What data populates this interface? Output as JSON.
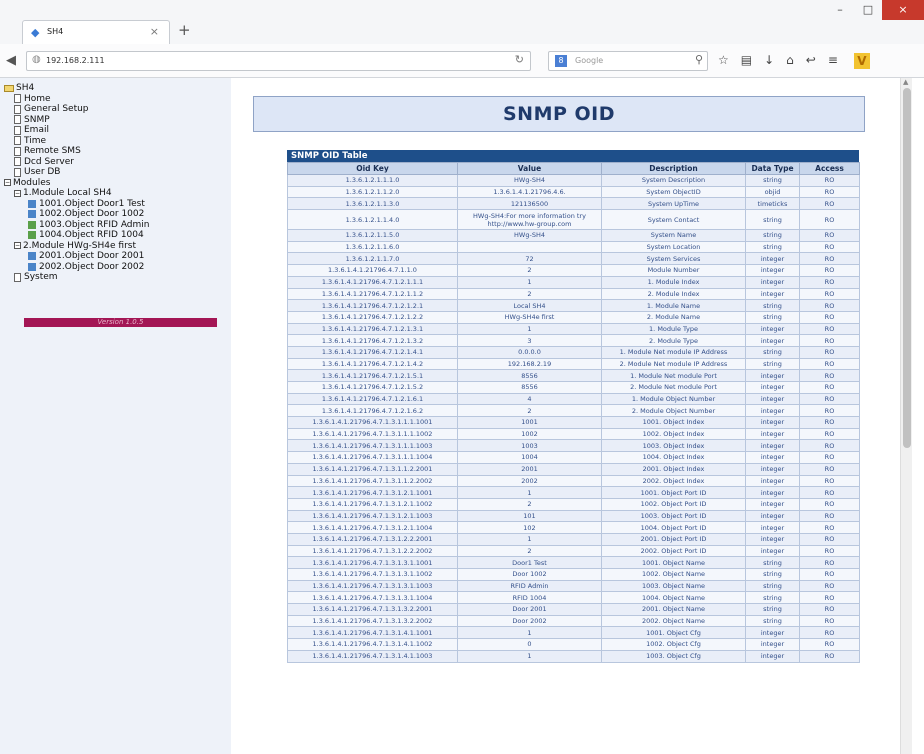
{
  "browser": {
    "tab_title": "SH4",
    "tab_close": "×",
    "new_tab": "+",
    "url": "192.168.2.111",
    "search_placeholder": "Google",
    "search_engine": "8"
  },
  "sidebar": {
    "root": "SH4",
    "items": [
      "Home",
      "General Setup",
      "SNMP",
      "Email",
      "Time",
      "Remote SMS",
      "Dcd Server",
      "User DB"
    ],
    "modules_label": "Modules",
    "module1": "1.Module Local SH4",
    "module1_objects": [
      "1001.Object Door1 Test",
      "1002.Object Door 1002",
      "1003.Object RFID Admin",
      "1004.Object RFID 1004"
    ],
    "module2": "2.Module HWg-SH4e first",
    "module2_objects": [
      "2001.Object Door 2001",
      "2002.Object Door 2002"
    ],
    "system": "System",
    "version": "Version 1.0.5"
  },
  "page": {
    "title": "SNMP OID",
    "table_caption": "SNMP OID Table",
    "columns": [
      "Oid Key",
      "Value",
      "Description",
      "Data Type",
      "Access"
    ]
  },
  "rows": [
    [
      "1.3.6.1.2.1.1.1.0",
      "HWg-SH4",
      "System Description",
      "string",
      "RO"
    ],
    [
      "1.3.6.1.2.1.1.2.0",
      "1.3.6.1.4.1.21796.4.6.",
      "System ObjectID",
      "objid",
      "RO"
    ],
    [
      "1.3.6.1.2.1.1.3.0",
      "121136500",
      "System UpTime",
      "timeticks",
      "RO"
    ],
    [
      "1.3.6.1.2.1.1.4.0",
      "HWg-SH4:For more information try http://www.hw-group.com",
      "System Contact",
      "string",
      "RO"
    ],
    [
      "1.3.6.1.2.1.1.5.0",
      "HWg-SH4",
      "System Name",
      "string",
      "RO"
    ],
    [
      "1.3.6.1.2.1.1.6.0",
      "",
      "System Location",
      "string",
      "RO"
    ],
    [
      "1.3.6.1.2.1.1.7.0",
      "72",
      "System Services",
      "integer",
      "RO"
    ],
    [
      "1.3.6.1.4.1.21796.4.7.1.1.0",
      "2",
      "Module Number",
      "integer",
      "RO"
    ],
    [
      "1.3.6.1.4.1.21796.4.7.1.2.1.1.1",
      "1",
      "1. Module Index",
      "integer",
      "RO"
    ],
    [
      "1.3.6.1.4.1.21796.4.7.1.2.1.1.2",
      "2",
      "2. Module Index",
      "integer",
      "RO"
    ],
    [
      "1.3.6.1.4.1.21796.4.7.1.2.1.2.1",
      "Local SH4",
      "1. Module Name",
      "string",
      "RO"
    ],
    [
      "1.3.6.1.4.1.21796.4.7.1.2.1.2.2",
      "HWg-SH4e first",
      "2. Module Name",
      "string",
      "RO"
    ],
    [
      "1.3.6.1.4.1.21796.4.7.1.2.1.3.1",
      "1",
      "1. Module Type",
      "integer",
      "RO"
    ],
    [
      "1.3.6.1.4.1.21796.4.7.1.2.1.3.2",
      "3",
      "2. Module Type",
      "integer",
      "RO"
    ],
    [
      "1.3.6.1.4.1.21796.4.7.1.2.1.4.1",
      "0.0.0.0",
      "1. Module Net module IP Address",
      "string",
      "RO"
    ],
    [
      "1.3.6.1.4.1.21796.4.7.1.2.1.4.2",
      "192.168.2.19",
      "2. Module Net module IP Address",
      "string",
      "RO"
    ],
    [
      "1.3.6.1.4.1.21796.4.7.1.2.1.5.1",
      "8556",
      "1. Module Net module Port",
      "integer",
      "RO"
    ],
    [
      "1.3.6.1.4.1.21796.4.7.1.2.1.5.2",
      "8556",
      "2. Module Net module Port",
      "integer",
      "RO"
    ],
    [
      "1.3.6.1.4.1.21796.4.7.1.2.1.6.1",
      "4",
      "1. Module Object Number",
      "integer",
      "RO"
    ],
    [
      "1.3.6.1.4.1.21796.4.7.1.2.1.6.2",
      "2",
      "2. Module Object Number",
      "integer",
      "RO"
    ],
    [
      "1.3.6.1.4.1.21796.4.7.1.3.1.1.1.1001",
      "1001",
      "1001. Object Index",
      "integer",
      "RO"
    ],
    [
      "1.3.6.1.4.1.21796.4.7.1.3.1.1.1.1002",
      "1002",
      "1002. Object Index",
      "integer",
      "RO"
    ],
    [
      "1.3.6.1.4.1.21796.4.7.1.3.1.1.1.1003",
      "1003",
      "1003. Object Index",
      "integer",
      "RO"
    ],
    [
      "1.3.6.1.4.1.21796.4.7.1.3.1.1.1.1004",
      "1004",
      "1004. Object Index",
      "integer",
      "RO"
    ],
    [
      "1.3.6.1.4.1.21796.4.7.1.3.1.1.2.2001",
      "2001",
      "2001. Object Index",
      "integer",
      "RO"
    ],
    [
      "1.3.6.1.4.1.21796.4.7.1.3.1.1.2.2002",
      "2002",
      "2002. Object Index",
      "integer",
      "RO"
    ],
    [
      "1.3.6.1.4.1.21796.4.7.1.3.1.2.1.1001",
      "1",
      "1001. Object Port ID",
      "integer",
      "RO"
    ],
    [
      "1.3.6.1.4.1.21796.4.7.1.3.1.2.1.1002",
      "2",
      "1002. Object Port ID",
      "integer",
      "RO"
    ],
    [
      "1.3.6.1.4.1.21796.4.7.1.3.1.2.1.1003",
      "101",
      "1003. Object Port ID",
      "integer",
      "RO"
    ],
    [
      "1.3.6.1.4.1.21796.4.7.1.3.1.2.1.1004",
      "102",
      "1004. Object Port ID",
      "integer",
      "RO"
    ],
    [
      "1.3.6.1.4.1.21796.4.7.1.3.1.2.2.2001",
      "1",
      "2001. Object Port ID",
      "integer",
      "RO"
    ],
    [
      "1.3.6.1.4.1.21796.4.7.1.3.1.2.2.2002",
      "2",
      "2002. Object Port ID",
      "integer",
      "RO"
    ],
    [
      "1.3.6.1.4.1.21796.4.7.1.3.1.3.1.1001",
      "Door1 Test",
      "1001. Object Name",
      "string",
      "RO"
    ],
    [
      "1.3.6.1.4.1.21796.4.7.1.3.1.3.1.1002",
      "Door 1002",
      "1002. Object Name",
      "string",
      "RO"
    ],
    [
      "1.3.6.1.4.1.21796.4.7.1.3.1.3.1.1003",
      "RFID Admin",
      "1003. Object Name",
      "string",
      "RO"
    ],
    [
      "1.3.6.1.4.1.21796.4.7.1.3.1.3.1.1004",
      "RFID 1004",
      "1004. Object Name",
      "string",
      "RO"
    ],
    [
      "1.3.6.1.4.1.21796.4.7.1.3.1.3.2.2001",
      "Door 2001",
      "2001. Object Name",
      "string",
      "RO"
    ],
    [
      "1.3.6.1.4.1.21796.4.7.1.3.1.3.2.2002",
      "Door 2002",
      "2002. Object Name",
      "string",
      "RO"
    ],
    [
      "1.3.6.1.4.1.21796.4.7.1.3.1.4.1.1001",
      "1",
      "1001. Object Cfg",
      "integer",
      "RO"
    ],
    [
      "1.3.6.1.4.1.21796.4.7.1.3.1.4.1.1002",
      "0",
      "1002. Object Cfg",
      "integer",
      "RO"
    ],
    [
      "1.3.6.1.4.1.21796.4.7.1.3.1.4.1.1003",
      "1",
      "1003. Object Cfg",
      "integer",
      "RO"
    ]
  ]
}
